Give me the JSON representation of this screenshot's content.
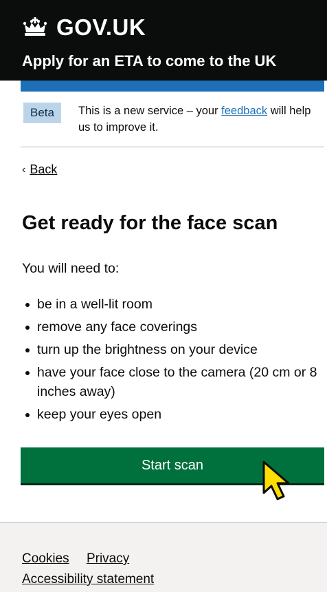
{
  "header": {
    "brand": "GOV.UK",
    "service_name": "Apply for an ETA to come to the UK",
    "logo_icon": "crown-icon"
  },
  "phase_banner": {
    "tag": "Beta",
    "text_before": "This is a new service – your ",
    "link": "feedback",
    "text_after": " will help us to improve it."
  },
  "back_link": {
    "label": "Back",
    "icon": "chevron-left-icon"
  },
  "main": {
    "title": "Get ready for the face scan",
    "lead": "You will need to:",
    "items": [
      "be in a well-lit room",
      "remove any face coverings",
      "turn up the brightness on your device",
      "have your face close to the camera (20 cm or 8 inches away)",
      "keep your eyes open"
    ],
    "start_button": "Start scan"
  },
  "footer": {
    "links": [
      "Cookies",
      "Privacy",
      "Accessibility statement"
    ]
  },
  "colors": {
    "header": "#0b0c0c",
    "blue_bar": "#1d70b8",
    "button": "#00703c",
    "tag_bg": "#bbd4ea",
    "footer_bg": "#f3f2f1",
    "cursor": "#ffdd00"
  }
}
